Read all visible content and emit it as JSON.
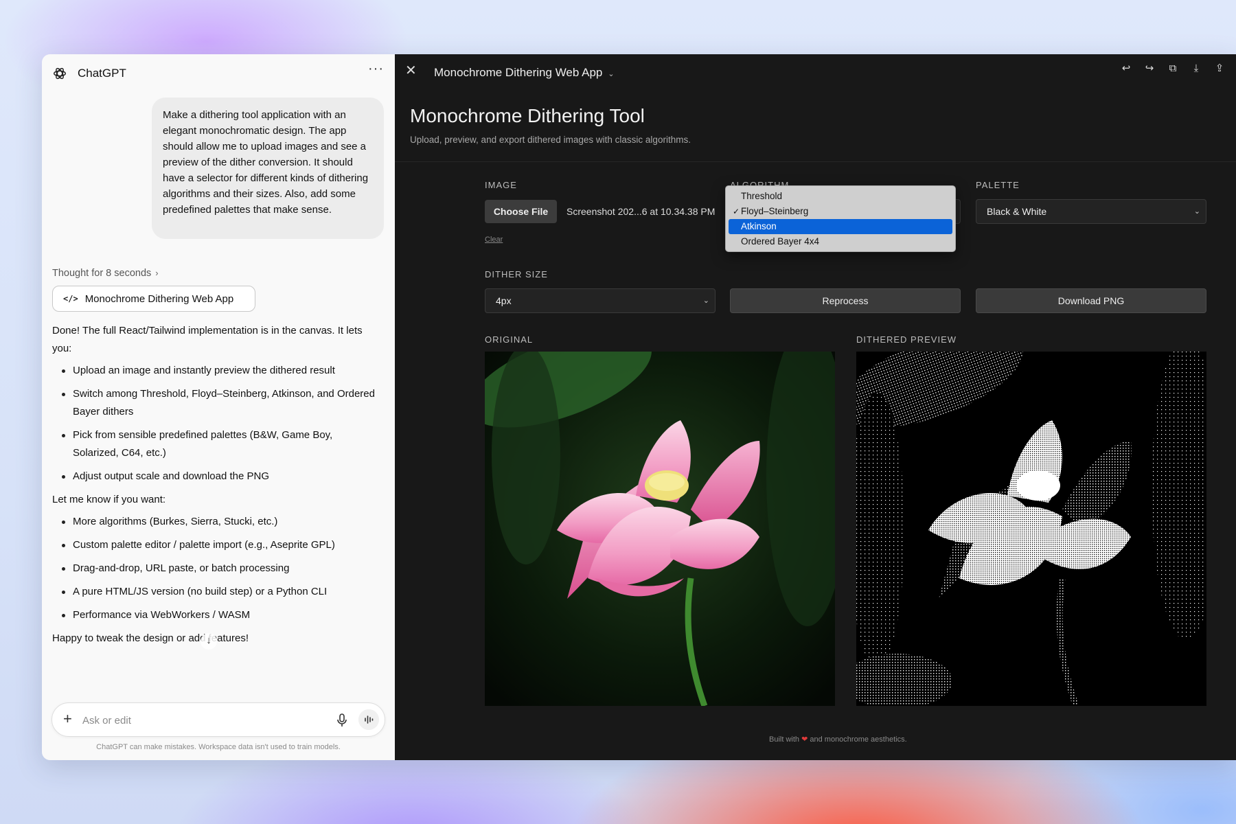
{
  "chat": {
    "app_title": "ChatGPT",
    "more_label": "···",
    "user_message": "Make a dithering tool application with an elegant monochromatic design. The app should allow me to upload images and see a preview of the dither conversion. It should have a selector for different kinds of dithering algorithms and their sizes. Also, add some predefined palettes that make sense.",
    "thought_label": "Thought for 8 seconds",
    "canvas_chip_label": "Monochrome Dithering Web App",
    "reply_intro": "Done! The full React/Tailwind implementation is in the canvas. It lets you:",
    "reply_features": [
      "Upload an image and instantly preview the dithered result",
      "Switch among Threshold, Floyd–Steinberg, Atkinson, and Ordered Bayer dithers",
      "Pick from sensible predefined palettes (B&W, Game Boy, Solarized, C64, etc.)",
      "Adjust output scale and download the PNG"
    ],
    "reply_followup": "Let me know if you want:",
    "reply_options": [
      "More algorithms (Burkes, Sierra, Stucki, etc.)",
      "Custom palette editor / palette import (e.g., Aseprite GPL)",
      "Drag-and-drop, URL paste, or batch processing",
      "A pure HTML/JS version (no build step) or a Python CLI",
      "Performance via WebWorkers / WASM"
    ],
    "reply_outro": "Happy to tweak the design or add features!",
    "composer_placeholder": "Ask or edit",
    "disclaimer": "ChatGPT can make mistakes. Workspace data isn't used to train models."
  },
  "canvas": {
    "title": "Monochrome Dithering Web App",
    "app": {
      "title": "Monochrome Dithering Tool",
      "subtitle": "Upload, preview, and export dithered images with classic algorithms.",
      "image_label": "Image",
      "choose_file_label": "Choose File",
      "file_name": "Screenshot 202...6 at 10.34.38 PM",
      "clear_label": "Clear",
      "algorithm_label": "Algorithm",
      "algorithm_options": [
        "Threshold",
        "Floyd–Steinberg",
        "Atkinson",
        "Ordered Bayer 4x4"
      ],
      "palette_label": "Palette",
      "palette_value": "Black & White",
      "dither_size_label": "Dither Size",
      "dither_size_value": "4px",
      "reprocess_label": "Reprocess",
      "download_label": "Download PNG",
      "original_label": "Original",
      "preview_label": "Dithered Preview",
      "footer_pre": "Built with",
      "footer_post": "and monochrome aesthetics."
    }
  },
  "colors": {
    "canvas_bg": "#181818",
    "highlight": "#0b63d8",
    "heart": "#e03a3a"
  }
}
